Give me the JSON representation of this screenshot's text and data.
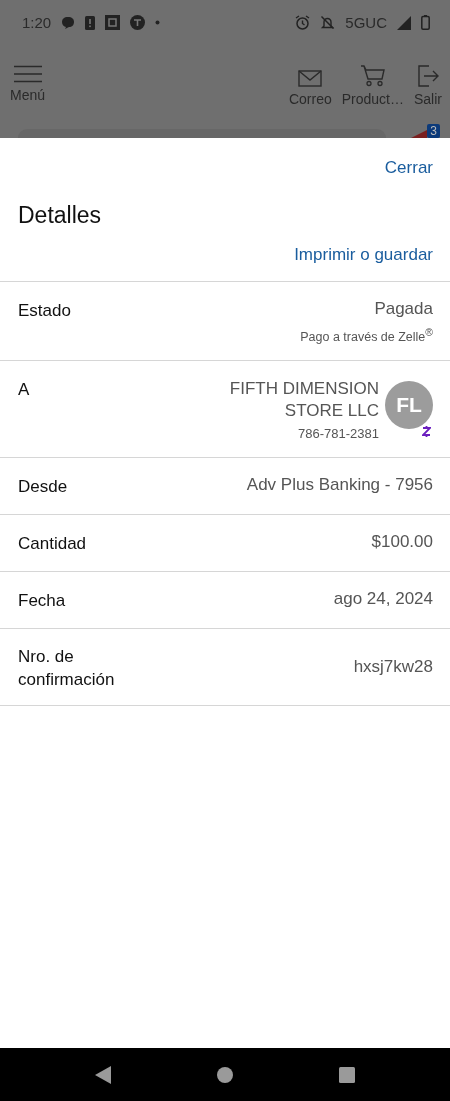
{
  "status_bar": {
    "time": "1:20",
    "network": "5GUC"
  },
  "header": {
    "menu": "Menú",
    "actions": [
      {
        "label": "Correo",
        "kind": "mail"
      },
      {
        "label": "Product…",
        "kind": "products"
      },
      {
        "label": "Salir",
        "kind": "logout"
      }
    ],
    "badge": "3"
  },
  "sheet": {
    "close": "Cerrar",
    "title": "Detalles",
    "print": "Imprimir o guardar",
    "rows": [
      {
        "kind": "status",
        "label": "Estado",
        "value": "Pagada",
        "note": "Pago a través de Zelle$^{®}$"
      },
      {
        "kind": "payee",
        "label": "A",
        "value": "FIFTH DIMENSION STORE LLC",
        "phone": "786-781-2381",
        "initials": "FL"
      },
      {
        "kind": "plain",
        "label": "Desde",
        "value": "Adv Plus Banking - 7956"
      },
      {
        "kind": "plain",
        "label": "Cantidad",
        "value": "$100.00"
      },
      {
        "kind": "plain",
        "label": "Fecha",
        "value": "ago 24, 2024"
      },
      {
        "kind": "plain",
        "label": "Nro. de confirmación",
        "value": "hxsj7kw28"
      }
    ]
  }
}
